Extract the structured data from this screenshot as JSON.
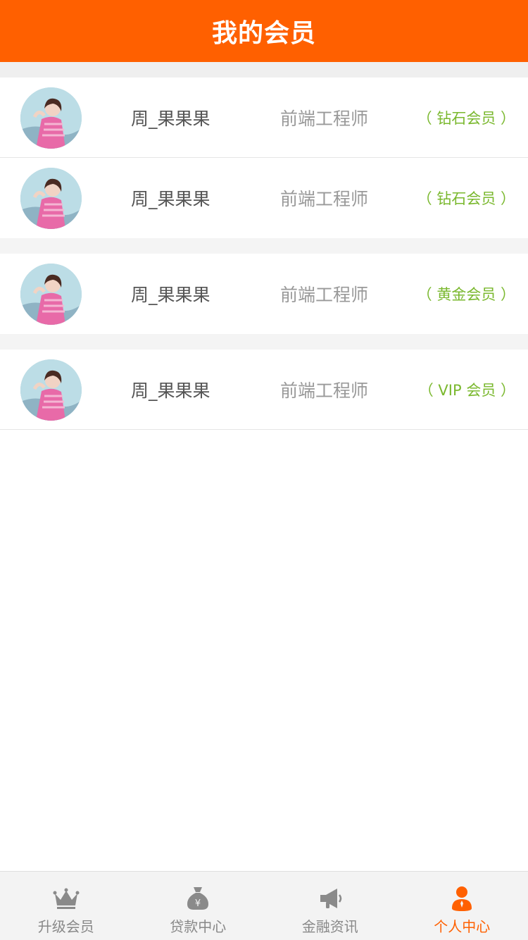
{
  "header": {
    "title": "我的会员"
  },
  "members": [
    {
      "name": "周_果果果",
      "job": "前端工程师",
      "level": "（ 钻石会员 ）"
    },
    {
      "name": "周_果果果",
      "job": "前端工程师",
      "level": "（ 钻石会员 ）"
    },
    {
      "name": "周_果果果",
      "job": "前端工程师",
      "level": "（ 黄金会员 ）"
    },
    {
      "name": "周_果果果",
      "job": "前端工程师",
      "level": "（ VIP 会员 ）"
    }
  ],
  "tabbar": {
    "items": [
      {
        "label": "升级会员",
        "icon": "crown-icon"
      },
      {
        "label": "贷款中心",
        "icon": "money-bag-icon"
      },
      {
        "label": "金融资讯",
        "icon": "megaphone-icon"
      },
      {
        "label": "个人中心",
        "icon": "person-icon",
        "active": true
      }
    ]
  },
  "colors": {
    "brand": "#ff6000",
    "level_text": "#7ab82e",
    "tab_inactive": "#888888"
  }
}
